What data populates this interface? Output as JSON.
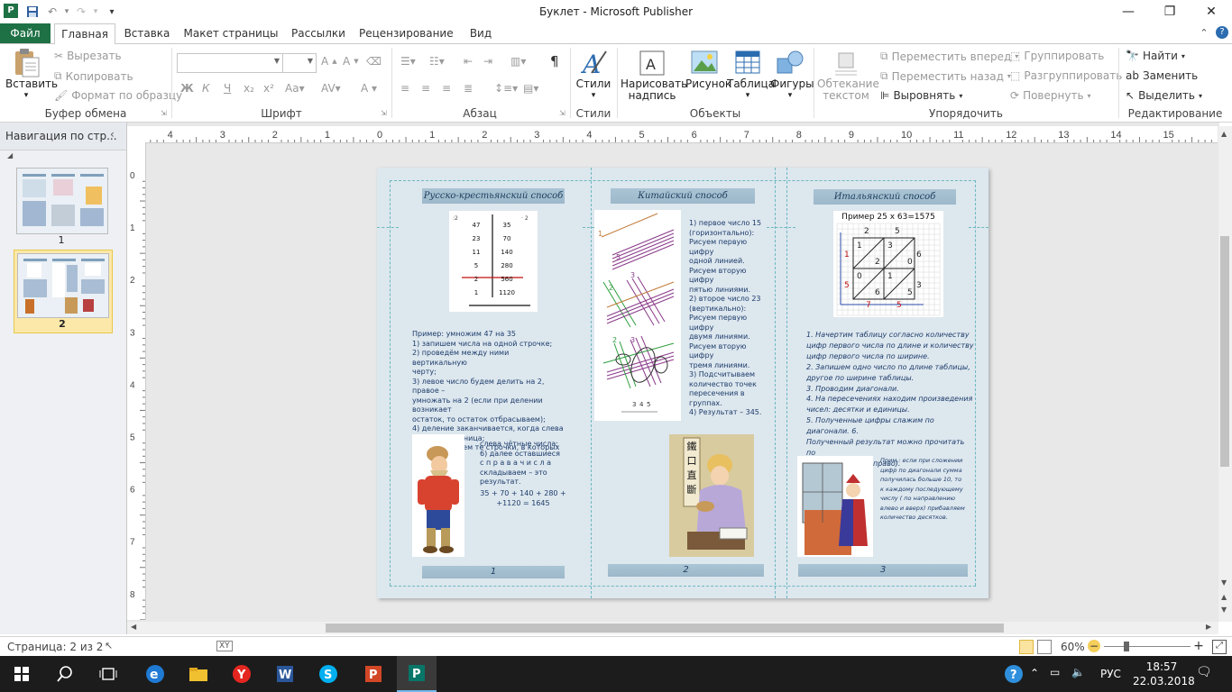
{
  "window": {
    "title": "Буклет  -  Microsoft Publisher",
    "minimize": "—",
    "restore": "❐",
    "close": "✕"
  },
  "ribbon_tabs": [
    {
      "label": "Файл"
    },
    {
      "label": "Главная"
    },
    {
      "label": "Вставка"
    },
    {
      "label": "Макет страницы"
    },
    {
      "label": "Рассылки"
    },
    {
      "label": "Рецензирование"
    },
    {
      "label": "Вид"
    }
  ],
  "ribbon": {
    "clipboard": {
      "paste": "Вставить",
      "cut": "Вырезать",
      "copy": "Копировать",
      "format_painter": "Формат по образцу",
      "label": "Буфер обмена"
    },
    "font": {
      "label": "Шрифт"
    },
    "paragraph": {
      "label": "Абзац"
    },
    "styles": {
      "button": "Стили",
      "label": "Стили"
    },
    "objects": {
      "text_box": "Нарисовать надпись",
      "picture": "Рисунок",
      "table": "Таблица",
      "shapes": "Фигуры",
      "label": "Объекты"
    },
    "arrange": {
      "wrap_text": "Обтекание текстом",
      "bring_forward": "Переместить вперед",
      "send_backward": "Переместить назад",
      "align": "Выровнять",
      "group": "Группировать",
      "ungroup": "Разгруппировать",
      "rotate": "Повернуть",
      "label": "Упорядочить"
    },
    "editing": {
      "find": "Найти",
      "replace": "Заменить",
      "select": "Выделить",
      "label": "Редактирование"
    }
  },
  "nav_pane": {
    "title": "Навигация по стр...",
    "pages": [
      {
        "label": "1"
      },
      {
        "label": "2"
      }
    ]
  },
  "ruler": {
    "h_labels": [
      "4",
      "3",
      "2",
      "1",
      "0",
      "1",
      "2",
      "3",
      "4",
      "5",
      "6",
      "7",
      "8",
      "9",
      "10",
      "11",
      "12",
      "13",
      "14",
      "15"
    ],
    "v_labels": [
      "0",
      "1",
      "2",
      "3",
      "4",
      "5",
      "6",
      "7",
      "8"
    ]
  },
  "page": {
    "col1": {
      "heading": "Русско-крестьянский способ",
      "table_rows": [
        [
          "47",
          "35"
        ],
        [
          "23",
          "70"
        ],
        [
          "11",
          "140"
        ],
        [
          "5",
          "280"
        ],
        [
          "2",
          "560"
        ],
        [
          "1",
          "1120"
        ]
      ],
      "table_markers": [
        ":2",
        "· 2"
      ],
      "text_lines": [
        "Пример: умножим 47 на 35",
        "1) запишем числа на одной строчке;",
        "2)  проведём  между  ними  вертикальную",
        "черту;",
        "3) левое число будем делить на 2, правое –",
        "умножать на 2 (если при делении возникает",
        "остаток, то остаток отбрасываем);",
        "4)  деление  заканчивается,  когда  слева",
        "появится единица;",
        "5)  вычёркиваем те строчки, в которых стоят"
      ],
      "side_lines": [
        "слева чётные числа;",
        "6)     далее     оставшиеся",
        "с п р а в а     ч и с л а",
        "складываем   –   это",
        "результат."
      ],
      "sum_lines": [
        "35 + 70 + 140 + 280 +",
        "+1120 =  1645"
      ],
      "footer": "1"
    },
    "col2": {
      "heading": "Китайский способ",
      "text_lines": [
        "1) первое число 15",
        "(горизонтально):",
        "Рисуем первую цифру",
        "одной линией.",
        "Рисуем вторую цифру",
        "пятью линиями.",
        "2) второе число 23",
        "(вертикально):",
        "Рисуем первую цифру",
        "двумя линиями.",
        "Рисуем вторую цифру",
        "тремя линиями.",
        "3) Подсчитываем",
        "количество точек",
        "пересечения в",
        "группах.",
        "4) Результат – 345."
      ],
      "diagram_numbers": [
        "1",
        "5",
        "3",
        "2",
        "3",
        "2",
        "3",
        "4",
        "5"
      ],
      "poster_chars": [
        "鐵",
        "口",
        "直",
        "斷"
      ],
      "footer": "2"
    },
    "col3": {
      "heading": "Итальянский способ",
      "grid_title": "Пример 25 х 63=1575",
      "grid_top": [
        "2",
        "5"
      ],
      "grid_right": [
        "6",
        "3"
      ],
      "grid_left": [
        "1",
        "5"
      ],
      "grid_bottom": [
        "7",
        "5"
      ],
      "grid_cells": [
        "1",
        "3",
        "2",
        "0",
        "0",
        "1",
        "6",
        "5"
      ],
      "text_lines": [
        " 1. Начертим таблицу согласно количеству",
        "цифр первого числа по длине и количеству",
        "цифр первого числа по ширине.",
        "2. Запишем одно число по длине таблицы,",
        "другое по ширине таблицы.",
        "3. Проводим диагонали.",
        " 4. На пересечениях находим произведения",
        "чисел: десятки и единицы.",
        "5. Полученные цифры слажим по диагонали. 6.",
        "Полученный результат можно прочитать по",
        "стрелке (вниз и вправо)."
      ],
      "note_lines": [
        "Прим.: если при сложении",
        "цифр по диагонали сумма",
        "получилась больше 10, то",
        "к каждому последующему",
        "числу  ( по направлению",
        "влево и вверх) прибавляем",
        "количество десятков."
      ],
      "footer": "3"
    }
  },
  "status": {
    "page": "Страница: 2 из 2",
    "zoom": "60%"
  },
  "taskbar": {
    "lang": "РУС",
    "time": "18:57",
    "date": "22.03.2018"
  },
  "colors": {
    "accent": "#1e7145",
    "page_bg": "#dde7ee",
    "head_bar": "#9cb8ca",
    "text_blue": "#1d3c6b"
  }
}
